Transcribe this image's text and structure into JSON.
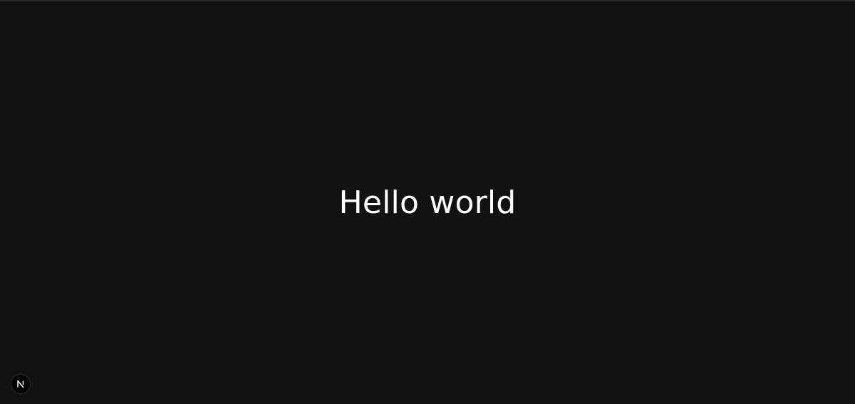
{
  "main": {
    "heading": "Hello world"
  },
  "dev_indicator": {
    "icon": "nextjs-logo-icon",
    "letter": "N"
  },
  "colors": {
    "background": "#121212",
    "text": "#ffffff",
    "badge_background": "#000000"
  }
}
